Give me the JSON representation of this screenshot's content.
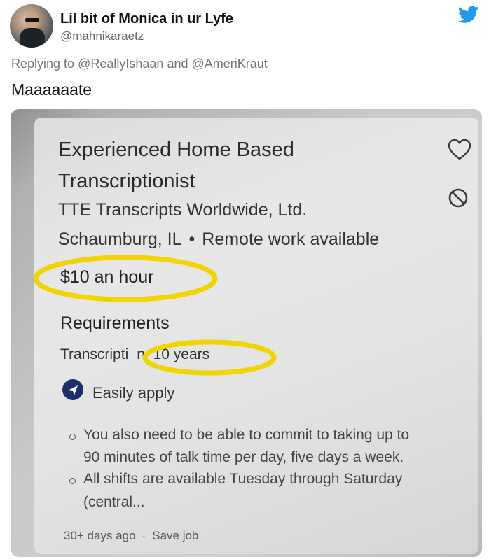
{
  "tweet": {
    "display_name": "Lil bit of Monica in ur Lyfe",
    "handle": "@mahnikaraetz",
    "replying_prefix": "Replying to",
    "replying_to_1": "@ReallyIshaan",
    "replying_and": "and",
    "replying_to_2": "@AmeriKraut",
    "text": "Maaaaaate",
    "brand_icon": "twitter-bird-icon",
    "brand_color": "#1d9bf0"
  },
  "job": {
    "title_line1": "Experienced Home Based",
    "title_line2": "Transcriptionist",
    "company": "TTE Transcripts Worldwide, Ltd.",
    "location": "Schaumburg, IL",
    "location_sep": "•",
    "remote": "Remote work available",
    "pay": "$10 an hour",
    "requirements_heading": "Requirements",
    "requirement_item_prefix": "Transcripti",
    "requirement_item_suffix": "n: 10 years",
    "apply_label": "Easily apply",
    "bullets": [
      {
        "line1": "You also need to be able to commit to taking up to",
        "line2": "90 minutes of talk time per day, five days a week."
      },
      {
        "line1": "All shifts are available Tuesday through Saturday",
        "line2": "(central..."
      }
    ],
    "posted": "30+ days ago",
    "footer_sep": "·",
    "save_job": "Save job",
    "icons": [
      "heart-icon",
      "block-icon",
      "paper-plane-icon"
    ],
    "highlight_color": "#f2d400"
  }
}
